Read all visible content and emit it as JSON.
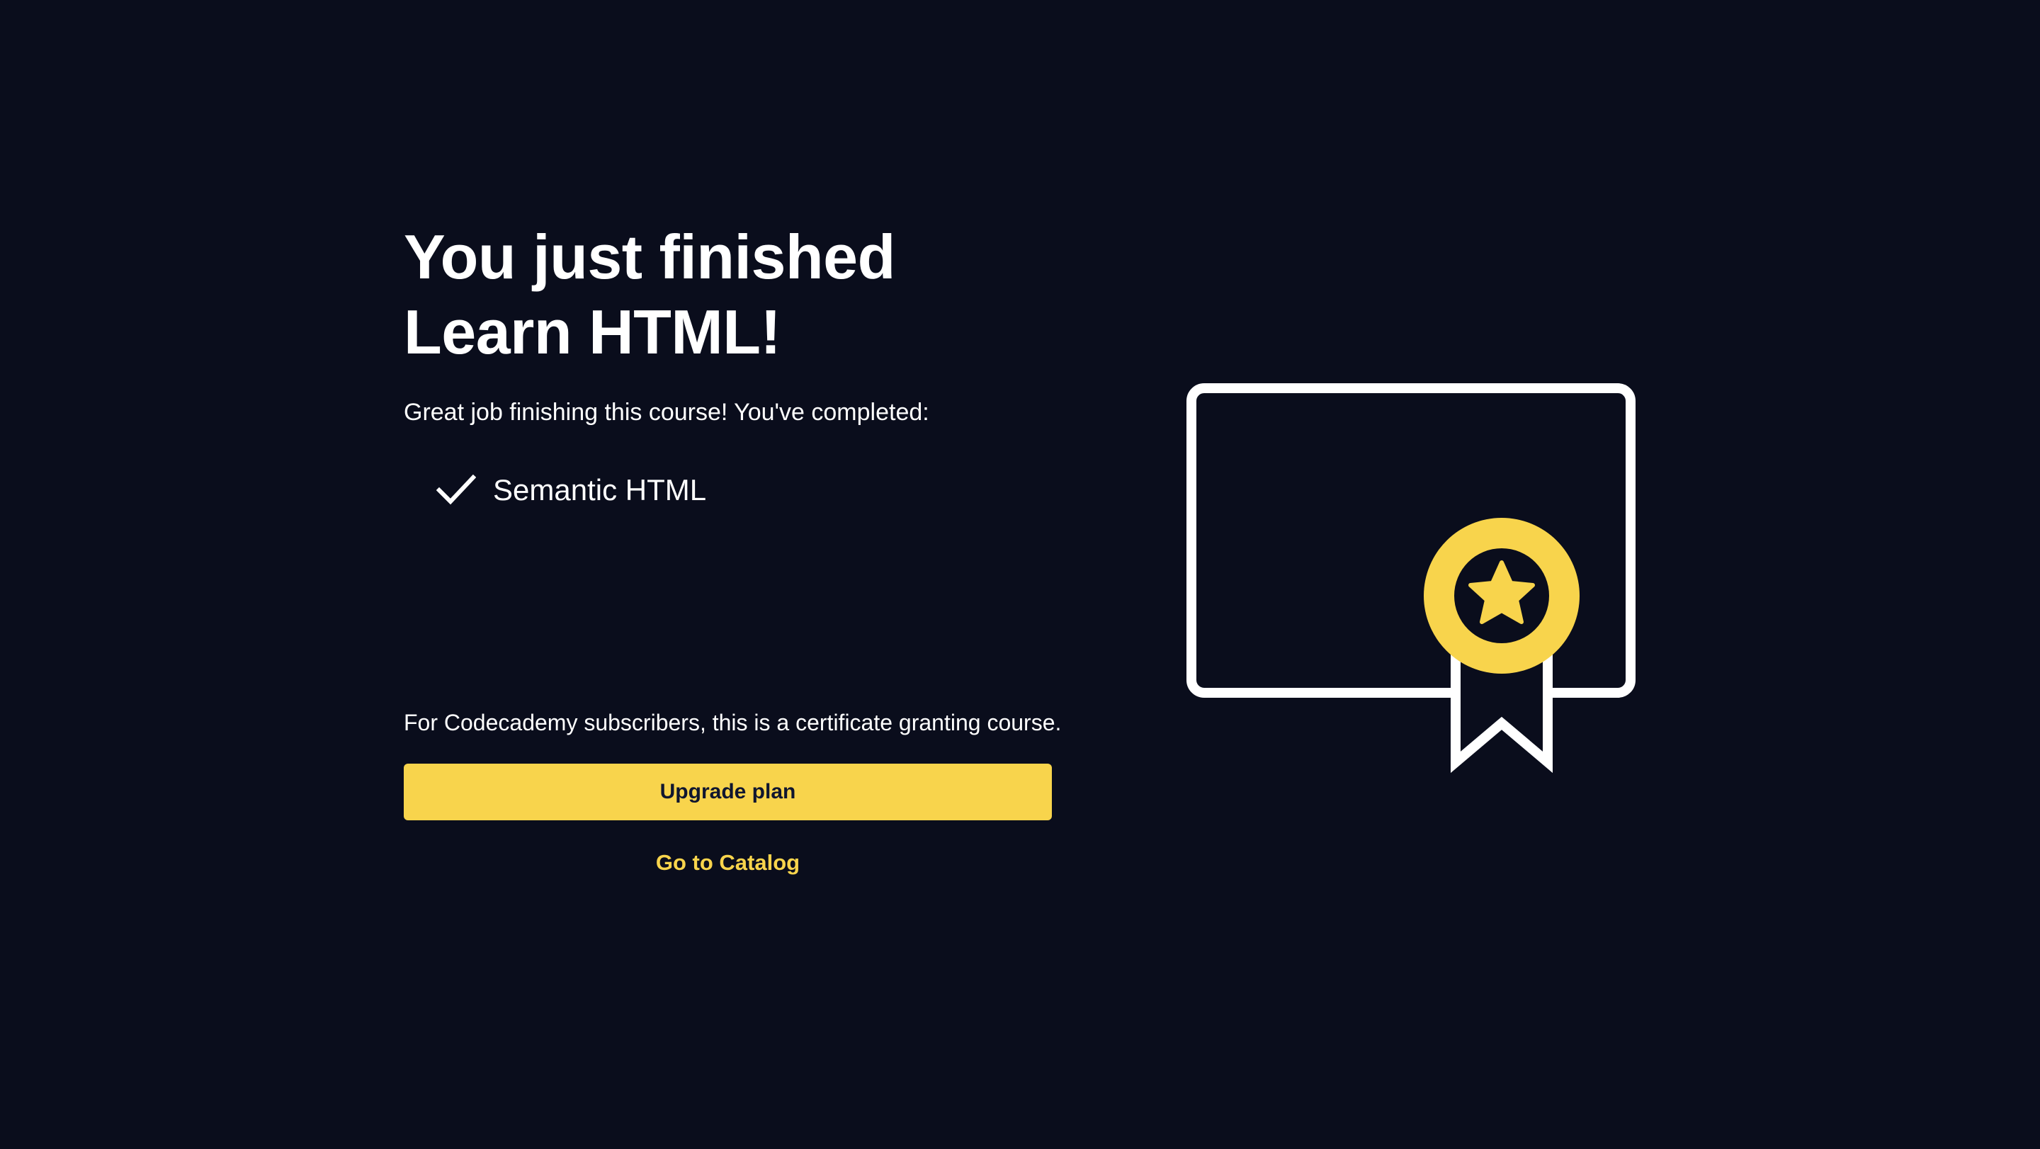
{
  "completion": {
    "title_line_1": "You just finished",
    "title_line_2": "Learn HTML!",
    "subtitle": "Great job finishing this course! You've completed:",
    "completed_items": [
      {
        "label": "Semantic HTML",
        "icon": "check-icon"
      }
    ]
  },
  "certificate_note": "For Codecademy subscribers, this is a certificate granting course.",
  "actions": {
    "upgrade_label": "Upgrade plan",
    "catalog_label": "Go to Catalog"
  },
  "illustration": {
    "icon": "certificate-icon",
    "badge_icon": "star-badge-icon"
  },
  "colors": {
    "background": "#0a0d1c",
    "accent": "#f8d44c",
    "text": "#ffffff",
    "button_text": "#10162f"
  }
}
